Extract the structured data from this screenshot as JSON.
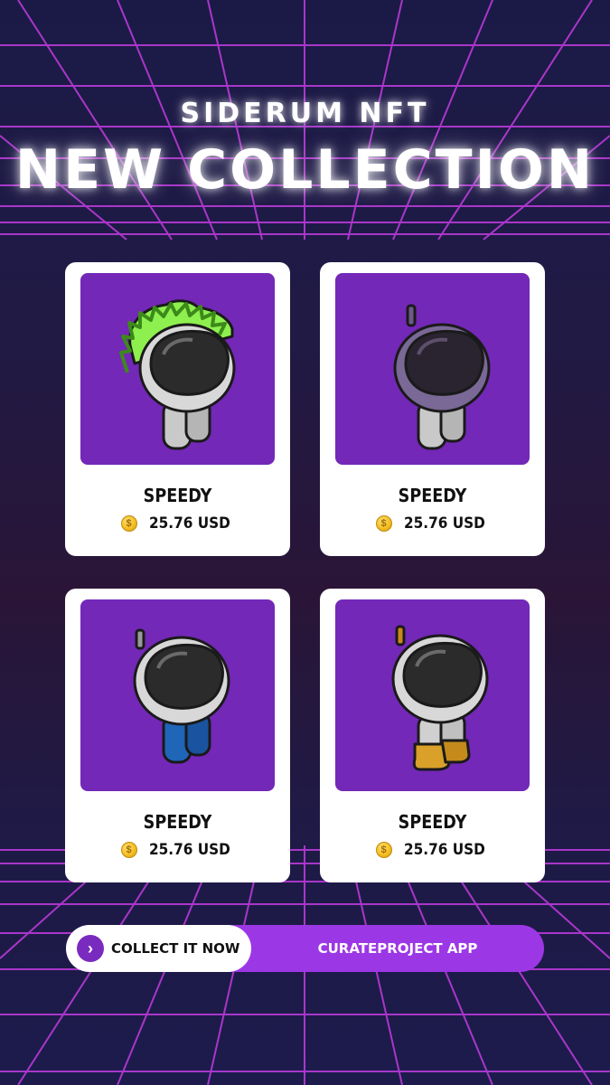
{
  "header": {
    "brand": "SIDERUM NFT",
    "headline": "NEW COLLECTION"
  },
  "cards": [
    {
      "title": "SPEEDY",
      "price": "25.76 USD",
      "icon": "mohawk-astronaut-icon",
      "variant": "mohawk"
    },
    {
      "title": "SPEEDY",
      "price": "25.76 USD",
      "icon": "purple-astronaut-icon",
      "variant": "purple"
    },
    {
      "title": "SPEEDY",
      "price": "25.76 USD",
      "icon": "blue-legs-astronaut-icon",
      "variant": "blue"
    },
    {
      "title": "SPEEDY",
      "price": "25.76 USD",
      "icon": "gold-boots-astronaut-icon",
      "variant": "boots"
    }
  ],
  "cta": {
    "primary_label": "COLLECT IT NOW",
    "secondary_label": "CURATEPROJECT APP"
  },
  "colors": {
    "accent": "#9c37e6",
    "card_art_bg": "#7328b8",
    "grid_line": "#c23be0",
    "coin": "#f4bf22"
  }
}
